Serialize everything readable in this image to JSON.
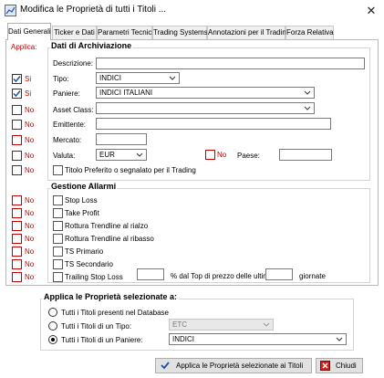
{
  "window": {
    "title": "Modifica le Proprietà di tutti i Titoli ..."
  },
  "tabs": [
    {
      "label": "Dati Generali"
    },
    {
      "label": "Ticker e Dati"
    },
    {
      "label": "Parametri Tecnici"
    },
    {
      "label": "Trading Systems"
    },
    {
      "label": "Annotazioni per il Trading"
    },
    {
      "label": "Forza Relativa"
    }
  ],
  "applica_label": "Applica:",
  "archiviazione": {
    "header": "Dati di Archiviazione",
    "descrizione": {
      "label": "Descrizione:",
      "value": ""
    },
    "tipo": {
      "label": "Tipo:",
      "value": "INDICI"
    },
    "paniere": {
      "label": "Paniere:",
      "value": "INDICI ITALIANI"
    },
    "asset_class": {
      "label": "Asset Class:",
      "value": ""
    },
    "emittente": {
      "label": "Emittente:",
      "value": ""
    },
    "mercato": {
      "label": "Mercato:",
      "value": ""
    },
    "valuta": {
      "label": "Valuta:",
      "value": "EUR"
    },
    "paese": {
      "label": "Paese:",
      "value": ""
    },
    "preferito": {
      "label": "Titolo Preferito o segnalato per il Trading"
    }
  },
  "apply_flags": {
    "yes": "Si",
    "no": "No",
    "rows_archiviazione": [
      true,
      true,
      false,
      false,
      false,
      false,
      false
    ],
    "valuta_paese_no": "No"
  },
  "allarmi": {
    "header": "Gestione Allarmi",
    "items": [
      {
        "label": "Stop Loss"
      },
      {
        "label": "Take Profit"
      },
      {
        "label": "Rottura Trendline al rialzo"
      },
      {
        "label": "Rottura Trendline al ribasso"
      },
      {
        "label": "TS Primario"
      },
      {
        "label": "TS Secondario"
      },
      {
        "label": "Trailing Stop Loss"
      }
    ],
    "trailing_days_text": "% dal Top di prezzo delle ultime",
    "trailing_unit": "giornate",
    "trailing_pct_value": "",
    "trailing_days_value": ""
  },
  "applica_selezionate": {
    "header": "Applica le Proprietà selezionate a:",
    "options": [
      {
        "label": "Tutti i Titoli presenti nel Database",
        "selected": false
      },
      {
        "label": "Tutti i Titoli di un Tipo:",
        "selected": false,
        "select_value": "ETC"
      },
      {
        "label": "Tutti i Titoli di un Paniere:",
        "selected": true,
        "select_value": "INDICI"
      }
    ]
  },
  "buttons": {
    "apply": "Applica le Proprietà selezionate ai Titoli",
    "close": "Chiudi"
  },
  "colors": {
    "no_red": "#c00000",
    "check_blue": "#1f4fa0"
  }
}
